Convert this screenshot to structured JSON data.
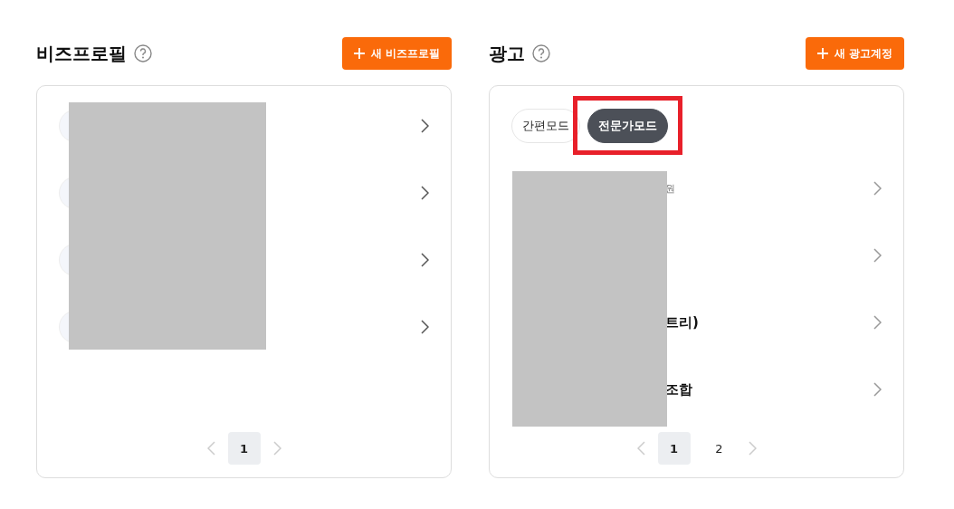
{
  "panels": [
    {
      "title": "비즈프로필",
      "add_button": "새 비즈프로필",
      "rows": [
        {
          "kind": "logo"
        },
        {
          "kind": "logo"
        },
        {
          "kind": "logo"
        },
        {
          "kind": "logo"
        }
      ],
      "pages": [
        {
          "label": "1",
          "selected": true
        }
      ]
    },
    {
      "title": "광고",
      "add_button": "새 광고계정",
      "modes": [
        {
          "label": "간편모드",
          "selected": false,
          "highlighted": false
        },
        {
          "label": "전문가모드",
          "selected": true,
          "highlighted": true
        }
      ],
      "rows": [
        {
          "kind": "account",
          "subtitle": "원"
        },
        {
          "kind": "account"
        },
        {
          "kind": "account",
          "title": "트리)"
        },
        {
          "kind": "account",
          "title": "조합"
        }
      ],
      "pages": [
        {
          "label": "1",
          "selected": true
        },
        {
          "label": "2",
          "selected": false
        }
      ]
    }
  ]
}
